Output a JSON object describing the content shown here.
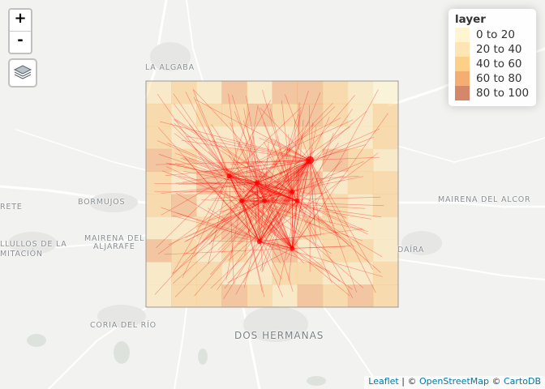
{
  "controls": {
    "zoom_in": "+",
    "zoom_out": "-"
  },
  "legend": {
    "title": "layer",
    "items": [
      {
        "label": "0 to 20",
        "color": "#fff3c4"
      },
      {
        "label": "20 to 40",
        "color": "#fde0a0"
      },
      {
        "label": "40 to 60",
        "color": "#fcc46c"
      },
      {
        "label": "60 to 80",
        "color": "#f2994f"
      },
      {
        "label": "80 to 100",
        "color": "#c96a44"
      }
    ]
  },
  "places": {
    "la_algaba": "LA ALGABA",
    "bormujos": "BORMUJOS",
    "mairena_aljarafe_1": "MAIRENA DEL",
    "mairena_aljarafe_2": "ALJARAFE",
    "castilleja": "RETE",
    "palomares_1": "LLULLOS DE LA",
    "palomares_2": "MITACIÓN",
    "mairena_alcor": "MAIRENA DEL ALCOR",
    "alcala": "DAÍRA",
    "coria": "CORIA DEL RÍO",
    "dos_hermanas": "DOS HERMANAS"
  },
  "attribution": {
    "leaflet": "Leaflet",
    "sep1": " | © ",
    "osm": "OpenStreetMap",
    "sep2": " © ",
    "carto": "CartoDB"
  },
  "raster": {
    "cols": 10,
    "rows": 10,
    "values": [
      [
        30,
        50,
        20,
        75,
        25,
        60,
        65,
        45,
        20,
        10
      ],
      [
        40,
        30,
        55,
        40,
        60,
        45,
        70,
        50,
        35,
        40
      ],
      [
        55,
        20,
        35,
        25,
        35,
        30,
        40,
        25,
        20,
        45
      ],
      [
        70,
        45,
        30,
        50,
        20,
        55,
        25,
        60,
        40,
        30
      ],
      [
        50,
        35,
        60,
        40,
        70,
        45,
        65,
        30,
        55,
        45
      ],
      [
        45,
        60,
        35,
        55,
        40,
        50,
        30,
        45,
        35,
        40
      ],
      [
        35,
        25,
        50,
        65,
        45,
        30,
        55,
        40,
        25,
        35
      ],
      [
        60,
        40,
        30,
        45,
        35,
        60,
        25,
        50,
        45,
        30
      ],
      [
        30,
        55,
        40,
        35,
        25,
        40,
        50,
        20,
        35,
        45
      ],
      [
        25,
        40,
        55,
        70,
        45,
        35,
        60,
        45,
        65,
        40
      ]
    ]
  },
  "hubs": [
    [
      0.65,
      0.35
    ],
    [
      0.33,
      0.42
    ],
    [
      0.38,
      0.53
    ],
    [
      0.47,
      0.53
    ],
    [
      0.58,
      0.49
    ],
    [
      0.6,
      0.53
    ],
    [
      0.44,
      0.45
    ],
    [
      0.45,
      0.71
    ],
    [
      0.58,
      0.74
    ]
  ]
}
